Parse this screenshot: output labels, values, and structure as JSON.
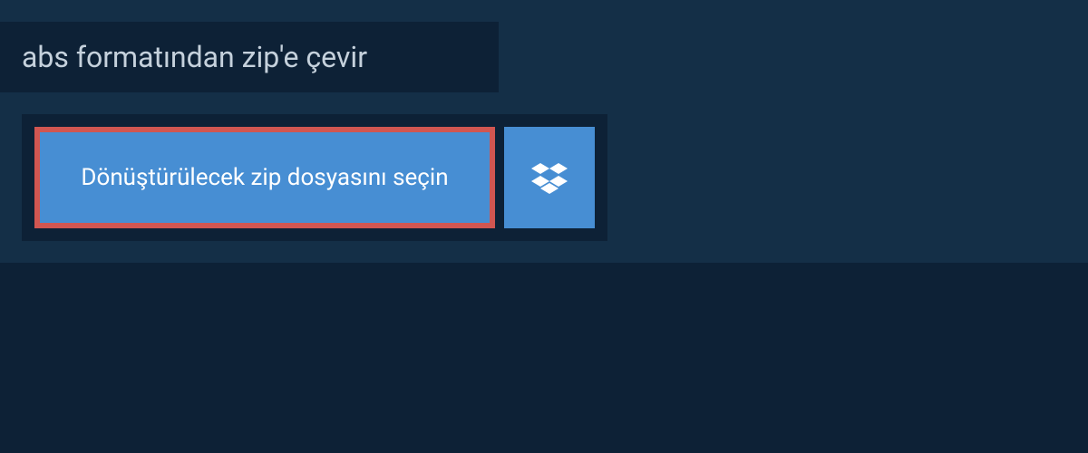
{
  "header": {
    "title": "abs formatından zip'e çevir"
  },
  "actions": {
    "select_file_label": "Dönüştürülecek zip dosyasını seçin",
    "dropbox_icon": "dropbox-icon"
  },
  "colors": {
    "background": "#142f47",
    "panel": "#0d2136",
    "button": "#478ed3",
    "highlight_border": "#d15651",
    "text_light": "#c5d1dc",
    "text_white": "#ffffff"
  }
}
